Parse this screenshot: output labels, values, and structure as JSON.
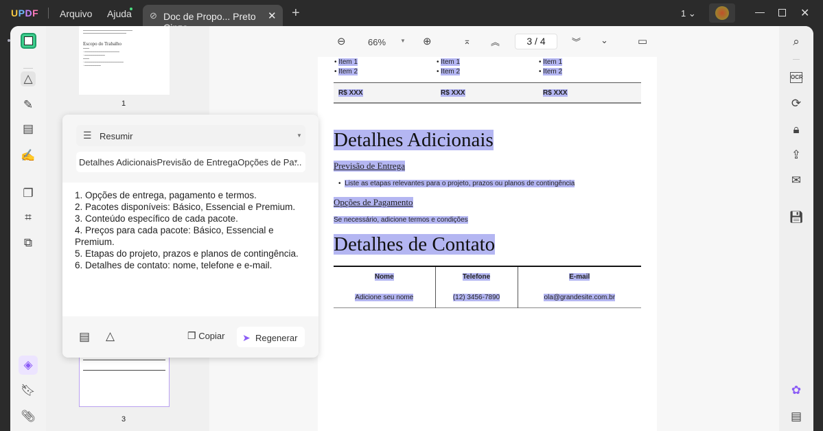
{
  "app": {
    "logo": "UPDF",
    "menu": [
      "Arquivo",
      "Ajuda"
    ],
    "tab_title": "Doc de Propo... Preto Cinza",
    "page_indicator": "1"
  },
  "toolbar": {
    "zoom": "66%",
    "current_page": "3",
    "total_pages": "4",
    "page_sep": "/"
  },
  "thumbnails": {
    "page1": {
      "heading": "Escopo do Trabalho",
      "label": "1"
    },
    "page3": {
      "label": "3"
    }
  },
  "document": {
    "items": [
      "Item 1",
      "Item 2"
    ],
    "price": "R$ XXX",
    "h1": "Detalhes Adicionais",
    "h2a": "Previsão de Entrega",
    "bullet": "Liste as etapas relevantes para o projeto, prazos ou planos de contingência",
    "h2b": "Opções de Pagamento",
    "para": "Se necessário, adicione termos e condições",
    "h1b": "Detalhes de Contato",
    "table": {
      "headers": [
        "Nome",
        "Telefone",
        "E-mail"
      ],
      "row": [
        "Adicione seu nome",
        "(12) 3456-7890",
        "ola@grandesite.com.br"
      ]
    }
  },
  "ai_panel": {
    "mode": "Resumir",
    "selection": "Detalhes AdicionaisPrevisão de EntregaOpções de Pa...",
    "summary": [
      "1. Opções de entrega, pagamento e termos.",
      "2. Pacotes disponíveis: Básico, Essencial e Premium.",
      "3. Conteúdo específico de cada pacote.",
      "4. Preços para cada pacote: Básico, Essencial e Premium.",
      "5. Etapas do projeto, prazos e planos de contingência.",
      "6. Detalhes de contato: nome, telefone e e-mail."
    ],
    "copy": "Copiar",
    "regenerate": "Regenerar"
  },
  "colors": {
    "accent": "#8b5cf6",
    "highlight": "#b4b6f2",
    "reader_active": "#3ecf8e"
  }
}
